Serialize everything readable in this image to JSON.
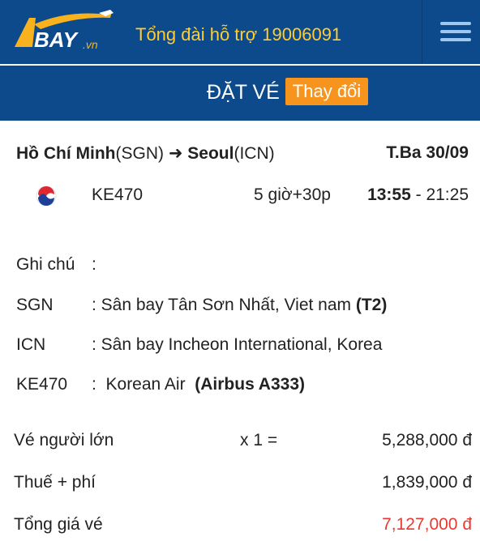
{
  "header": {
    "logo_text": "BAY.vn",
    "hotline": "Tổng đài hỗ trợ 19006091",
    "menu_icon": "hamburger-menu-icon"
  },
  "booking_bar": {
    "title": "ĐẶT VÉ",
    "change_label": "Thay đổi"
  },
  "flight": {
    "from_city": "Hồ Chí Minh",
    "from_code": "(SGN)",
    "arrow": "➜",
    "to_city": "Seoul",
    "to_code": "(ICN)",
    "date": "T.Ba 30/09",
    "airline_icon": "korean-air-logo",
    "flight_no": "KE470",
    "duration": "5 giờ+30p",
    "depart": "13:55",
    "arrive_sep": " - 21:25"
  },
  "details": {
    "note_label": "Ghi chú",
    "note_value": ":",
    "sgn_label": "SGN",
    "sgn_value": ": Sân bay Tân Sơn Nhất, Viet nam",
    "sgn_terminal": "(T2)",
    "icn_label": "ICN",
    "icn_value": ": Sân bay Incheon International, Korea",
    "flight_label": "KE470",
    "flight_value": ":  Korean Air ",
    "aircraft": "(Airbus A333)"
  },
  "prices": {
    "adult_label": "Vé người lớn",
    "adult_qty": "x 1 =",
    "adult_amount": "5,288,000 đ",
    "tax_label": "Thuế + phí",
    "tax_amount": "1,839,000 đ",
    "total_label": "Tổng giá vé",
    "total_amount": "7,127,000 đ"
  },
  "colors": {
    "brand_blue": "#0d4a8c",
    "accent_orange": "#f7941d",
    "total_red": "#e53b32",
    "hotline_yellow": "#ffcc33"
  }
}
